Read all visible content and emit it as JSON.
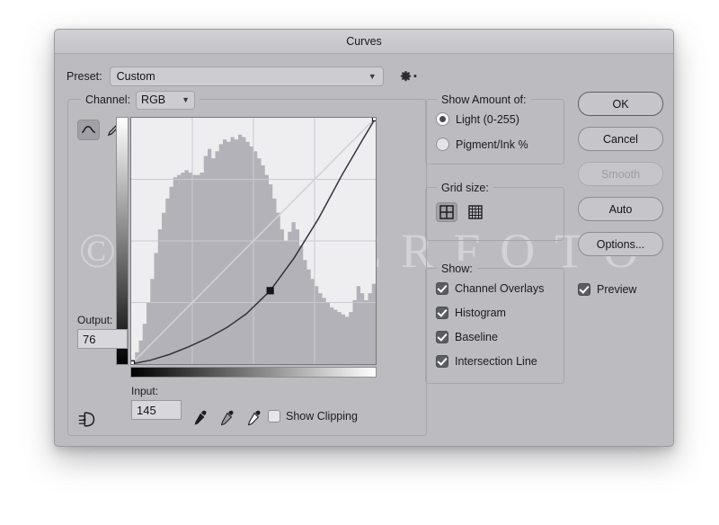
{
  "window": {
    "title": "Curves"
  },
  "preset": {
    "label": "Preset:",
    "value": "Custom",
    "chevron": "chevron-down-icon",
    "gear": "gear-icon"
  },
  "channel": {
    "label": "Channel:",
    "value": "RGB",
    "chevron": "chevron-down-icon",
    "tools": [
      {
        "name": "curve-tool",
        "selected": true
      },
      {
        "name": "pencil-tool",
        "selected": false
      }
    ]
  },
  "fields": {
    "output_label": "Output:",
    "output_value": "76",
    "input_label": "Input:",
    "input_value": "145"
  },
  "bottom": {
    "smooth_icon": "smooth-curve-icon",
    "eyedroppers": [
      "eyedropper-black-icon",
      "eyedropper-gray-icon",
      "eyedropper-white-icon"
    ],
    "show_clipping_label": "Show Clipping",
    "show_clipping_checked": false
  },
  "show_amount": {
    "legend": "Show Amount of:",
    "options": [
      {
        "label": "Light  (0-255)",
        "selected": true
      },
      {
        "label": "Pigment/Ink %",
        "selected": false
      }
    ]
  },
  "grid_size": {
    "legend": "Grid size:",
    "options": [
      {
        "name": "grid-4-icon",
        "selected": true
      },
      {
        "name": "grid-10-icon",
        "selected": false
      }
    ]
  },
  "show": {
    "legend": "Show:",
    "items": [
      {
        "label": "Channel Overlays",
        "checked": true
      },
      {
        "label": "Histogram",
        "checked": true
      },
      {
        "label": "Baseline",
        "checked": true
      },
      {
        "label": "Intersection Line",
        "checked": true
      }
    ]
  },
  "buttons": [
    {
      "label": "OK",
      "style": "primary"
    },
    {
      "label": "Cancel",
      "style": "normal"
    },
    {
      "label": "Smooth",
      "style": "disabled"
    },
    {
      "label": "Auto",
      "style": "normal"
    },
    {
      "label": "Options...",
      "style": "normal"
    }
  ],
  "preview": {
    "label": "Preview",
    "checked": true
  },
  "watermark": {
    "text": "© IJOYERFOTO"
  },
  "colors": {
    "dialog_bg": "#bcbcc0",
    "plot_bg": "#eeeef0",
    "histogram": "#b2b2b8",
    "curve": "#33333a",
    "baseline": "#d2d2d6",
    "accent_selected": "#5c5c63"
  },
  "chart_data": {
    "type": "line",
    "title": "Curves tone curve",
    "xlabel": "Input",
    "ylabel": "Output",
    "xlim": [
      0,
      255
    ],
    "ylim": [
      0,
      255
    ],
    "grid": true,
    "grid_divisions": 4,
    "series": [
      {
        "name": "baseline",
        "x": [
          0,
          255
        ],
        "y": [
          0,
          255
        ]
      },
      {
        "name": "tone-curve",
        "control_points": [
          {
            "input": 0,
            "output": 0
          },
          {
            "input": 145,
            "output": 76
          },
          {
            "input": 255,
            "output": 255
          }
        ],
        "x": [
          0,
          20,
          40,
          60,
          80,
          100,
          120,
          145,
          170,
          195,
          220,
          240,
          255
        ],
        "y": [
          0,
          4,
          10,
          18,
          27,
          38,
          52,
          76,
          110,
          150,
          196,
          230,
          255
        ]
      }
    ],
    "histogram": {
      "name": "RGB histogram",
      "bins": 64,
      "values": [
        2,
        5,
        10,
        17,
        26,
        36,
        47,
        57,
        64,
        70,
        75,
        79,
        80,
        81,
        82,
        81,
        80,
        80,
        81,
        88,
        91,
        87,
        90,
        93,
        95,
        94,
        96,
        95,
        97,
        96,
        94,
        92,
        90,
        87,
        84,
        80,
        76,
        70,
        64,
        57,
        52,
        56,
        60,
        57,
        50,
        44,
        40,
        36,
        33,
        30,
        28,
        26,
        24,
        23,
        22,
        21,
        20,
        22,
        27,
        33,
        30,
        27,
        30,
        34
      ],
      "max": 100
    }
  }
}
